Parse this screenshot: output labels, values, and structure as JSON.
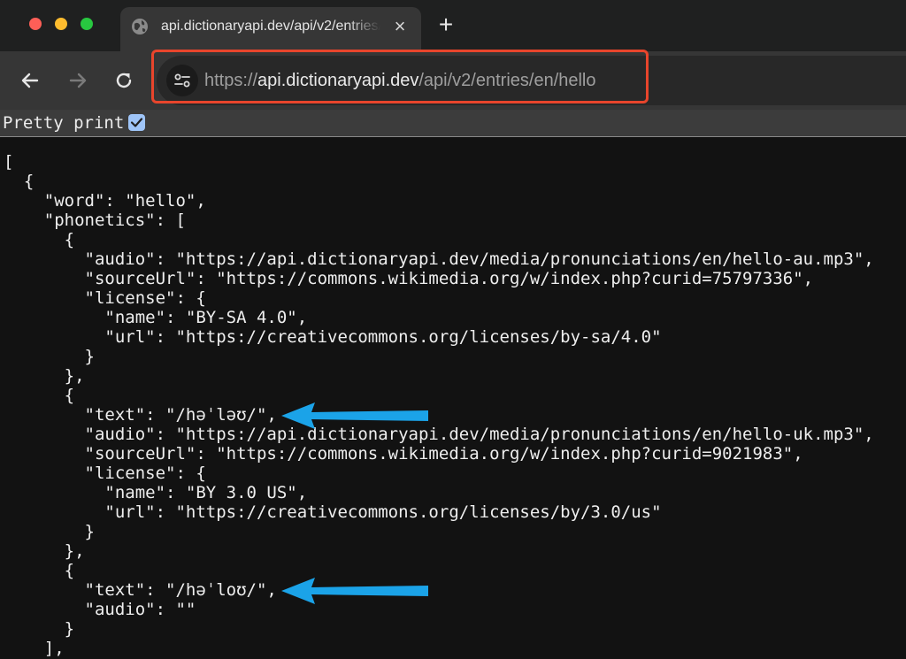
{
  "tab": {
    "title": "api.dictionaryapi.dev/api/v2/entries/en/hello",
    "close_icon": "close-icon",
    "favicon": "globe-icon"
  },
  "newtab": {
    "label": "+"
  },
  "address": {
    "scheme": "https://",
    "host": "api.dictionaryapi.dev",
    "path": "/api/v2/entries/en/hello",
    "highlight_color": "#e8452c"
  },
  "pretty_print": {
    "label": "Pretty print",
    "checked": true
  },
  "json_lines": [
    "[",
    "  {",
    "    \"word\": \"hello\",",
    "    \"phonetics\": [",
    "      {",
    "        \"audio\": \"https://api.dictionaryapi.dev/media/pronunciations/en/hello-au.mp3\",",
    "        \"sourceUrl\": \"https://commons.wikimedia.org/w/index.php?curid=75797336\",",
    "        \"license\": {",
    "          \"name\": \"BY-SA 4.0\",",
    "          \"url\": \"https://creativecommons.org/licenses/by-sa/4.0\"",
    "        }",
    "      },",
    "      {",
    "        \"text\": \"/həˈləʊ/\",",
    "        \"audio\": \"https://api.dictionaryapi.dev/media/pronunciations/en/hello-uk.mp3\",",
    "        \"sourceUrl\": \"https://commons.wikimedia.org/w/index.php?curid=9021983\",",
    "        \"license\": {",
    "          \"name\": \"BY 3.0 US\",",
    "          \"url\": \"https://creativecommons.org/licenses/by/3.0/us\"",
    "        }",
    "      },",
    "      {",
    "        \"text\": \"/həˈloʊ/\",",
    "        \"audio\": \"\"",
    "      }",
    "    ],"
  ],
  "colors": {
    "annotation_arrow": "#1ba3e8",
    "window_dark": "#1f2020",
    "toolbar": "#363636"
  }
}
